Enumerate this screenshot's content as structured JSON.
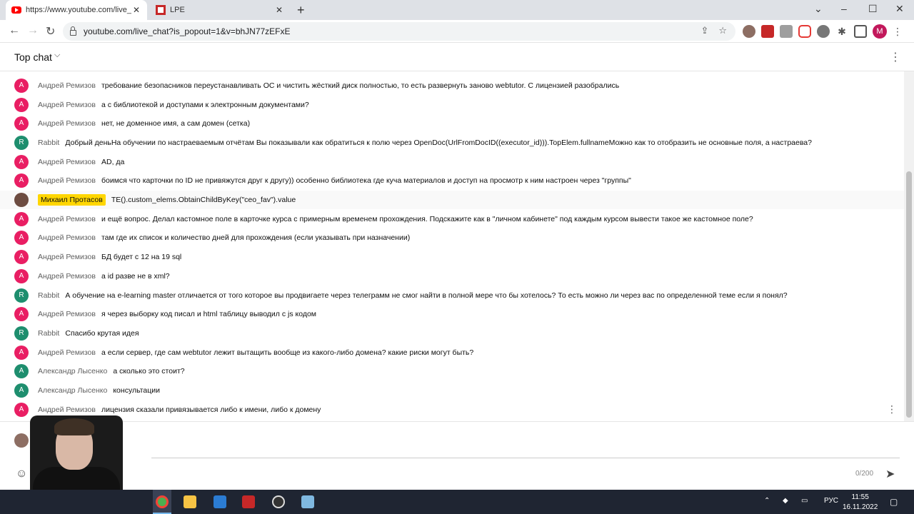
{
  "browser": {
    "tabs": [
      {
        "title": "https://www.youtube.com/live_ch",
        "close": "✕"
      },
      {
        "title": "LPE",
        "close": "✕"
      }
    ],
    "new_tab": "+",
    "window_controls": {
      "minimize": "–",
      "maximize": "☐",
      "close": "✕"
    },
    "url": "youtube.com/live_chat?is_popout=1&v=bhJN77zEFxE",
    "profile_initial": "M"
  },
  "chat": {
    "header_title": "Top chat",
    "messages": [
      {
        "initial": "А",
        "color": "#e91e63",
        "author": "Андрей Ремизов",
        "text": "требование безопасников переустанавливать ОС и чистить жёсткий диск полностью, то есть развернуть заново webtutor. С лицензией разобрались"
      },
      {
        "initial": "А",
        "color": "#e91e63",
        "author": "Андрей Ремизов",
        "text": "а с библиотекой и доступами к электронным документами?"
      },
      {
        "initial": "А",
        "color": "#e91e63",
        "author": "Андрей Ремизов",
        "text": "нет, не доменное имя, а сам домен (сетка)"
      },
      {
        "initial": "R",
        "color": "#1e8e6e",
        "author": "Rabbit",
        "text": "Добрый деньНа обучении по настраеваемым отчётам Вы показывали как обратиться к полю через OpenDoc(UrlFromDocID((executor_id))).TopElem.fullnameМожно как то отобразить не основные поля, а настраева?"
      },
      {
        "initial": "А",
        "color": "#e91e63",
        "author": "Андрей Ремизов",
        "text": "AD, да"
      },
      {
        "initial": "А",
        "color": "#e91e63",
        "author": "Андрей Ремизов",
        "text": "боимся что карточки по ID не привяжутся друг к другу)) особенно библиотека где куча материалов и доступ на просмотр к ним настроен через \"группы\""
      },
      {
        "initial": "",
        "color": "#6d4c41",
        "author": "Михаил Протасов",
        "text": "TE().custom_elems.ObtainChildByKey(\"ceo_fav\").value",
        "moderator": true
      },
      {
        "initial": "А",
        "color": "#e91e63",
        "author": "Андрей Ремизов",
        "text": "и ещё вопрос. Делал кастомное поле в карточке курса с примерным временем прохождения. Подскажите как в \"личном кабинете\" под каждым курсом вывести такое же кастомное поле?"
      },
      {
        "initial": "А",
        "color": "#e91e63",
        "author": "Андрей Ремизов",
        "text": "там где их список и количество дней для прохождения (если указывать при назначении)"
      },
      {
        "initial": "А",
        "color": "#e91e63",
        "author": "Андрей Ремизов",
        "text": "БД будет с 12 на 19 sql"
      },
      {
        "initial": "А",
        "color": "#e91e63",
        "author": "Андрей Ремизов",
        "text": "а id разве не в xml?"
      },
      {
        "initial": "R",
        "color": "#1e8e6e",
        "author": "Rabbit",
        "text": "А обучение на e-learning master отличается от того которое вы продвигаете через телеграмм не смог найти в полной мере что бы хотелось? То есть можно ли через вас по определенной теме если я понял?"
      },
      {
        "initial": "А",
        "color": "#e91e63",
        "author": "Андрей Ремизов",
        "text": "я через выборку код писал и html таблицу выводил с js кодом"
      },
      {
        "initial": "R",
        "color": "#1e8e6e",
        "author": "Rabbit",
        "text": "Спасибо крутая идея"
      },
      {
        "initial": "А",
        "color": "#e91e63",
        "author": "Андрей Ремизов",
        "text": "а если сервер, где сам webtutor лежит вытащить вообще из какого-либо домена? какие риски могут быть?"
      },
      {
        "initial": "А",
        "color": "#1e8e6e",
        "author": "Александр Лысенко",
        "text": "а сколько это стоит?"
      },
      {
        "initial": "А",
        "color": "#1e8e6e",
        "author": "Александр Лысенко",
        "text": "консультации"
      },
      {
        "initial": "А",
        "color": "#e91e63",
        "author": "Андрей Ремизов",
        "text": "лицензия сказали привязывается либо к имени, либо к домену"
      }
    ],
    "char_counter": "0/200"
  },
  "taskbar": {
    "language": "РУС",
    "time": "11:55",
    "date": "16.11.2022"
  },
  "colors": {
    "moderator_badge": "#ffd600",
    "taskbar_bg": "#1f2532"
  }
}
